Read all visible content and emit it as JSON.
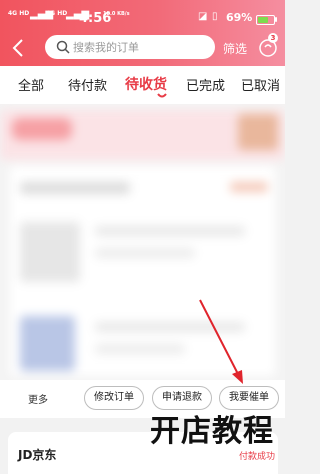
{
  "status_bar": {
    "signal_left": "4G HD",
    "signal_right": "4G HD",
    "time": "4:56",
    "speed": "18.0 KB/s",
    "battery_pct": "69%",
    "battery_level": 0.69
  },
  "header": {
    "search_placeholder": "搜索我的订单",
    "filter_label": "筛选",
    "gift_badge_count": "3"
  },
  "tabs": [
    {
      "label": "全部",
      "active": false
    },
    {
      "label": "待付款",
      "active": false
    },
    {
      "label": "待收货",
      "active": true
    },
    {
      "label": "已完成",
      "active": false
    },
    {
      "label": "已取消",
      "active": false
    }
  ],
  "actions": {
    "more_label": "更多",
    "buttons": [
      "修改订单",
      "申请退款",
      "我要催单"
    ]
  },
  "next_order": {
    "store_name": "JD京东",
    "status": "付款成功"
  },
  "watermark": "开店教程",
  "colors": {
    "accent": "#e83b46",
    "header_start": "#f1545e",
    "header_end": "#f58ea0"
  }
}
